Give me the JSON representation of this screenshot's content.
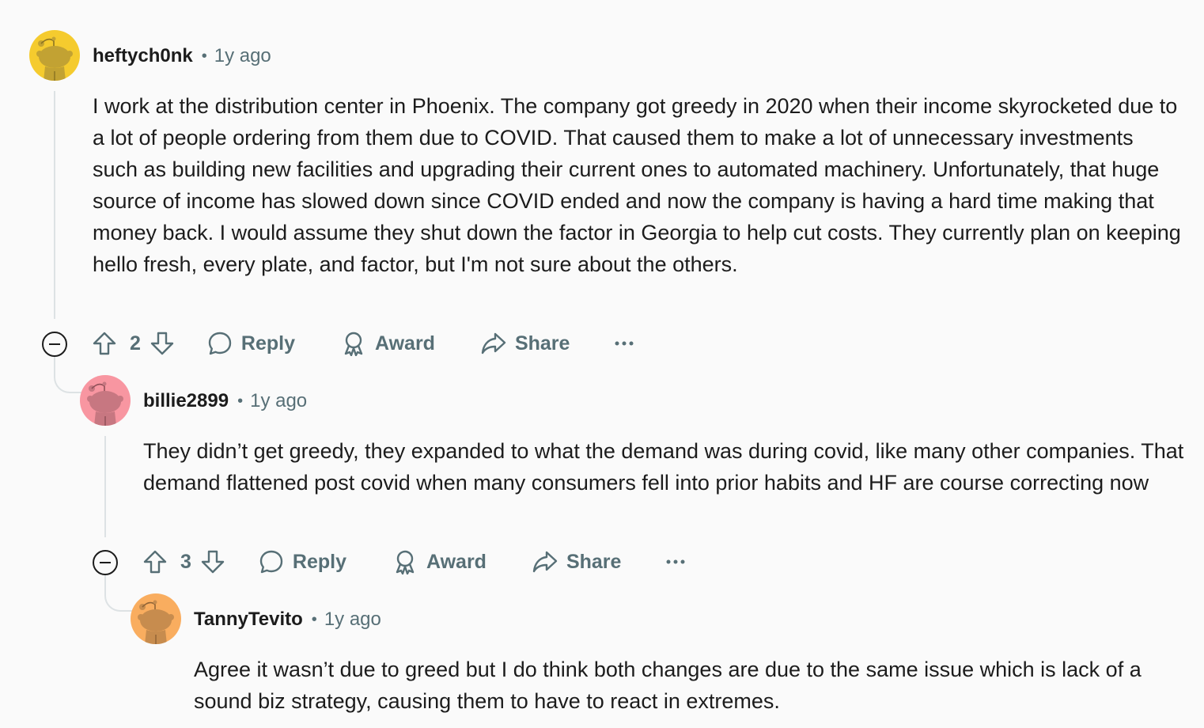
{
  "comments": [
    {
      "username": "heftych0nk",
      "separator": "•",
      "time": "1y ago",
      "body": "I work at the distribution center in Phoenix. The company got greedy in 2020 when their income skyrocketed due to a lot of people ordering from them due to COVID. That caused them to make a lot of unnecessary investments such as building new facilities and upgrading their current ones to automated machinery. Unfortunately, that huge source of income has slowed down since COVID ended and now the company is having a hard time making that money back. I would assume they shut down the factor in Georgia to help cut costs. They currently plan on keeping hello fresh, every plate, and factor, but I'm not sure about the others.",
      "votes": "2",
      "avatar_color": "#f5cb2e",
      "avatar_figure_color": "#c2a233"
    },
    {
      "username": "billie2899",
      "separator": "•",
      "time": "1y ago",
      "body": "They didn’t get greedy, they expanded to what the demand was during covid, like many other companies. That demand flattened post covid when many consumers fell into prior habits and HF are course correcting now",
      "votes": "3",
      "avatar_color": "#f896a1",
      "avatar_figure_color": "#c77781"
    },
    {
      "username": "TannyTevito",
      "separator": "•",
      "time": "1y ago",
      "body": "Agree it wasn’t due to greed but I do think both changes are due to the same issue which is lack of a sound biz strategy, causing them to have to react in extremes.",
      "avatar_color": "#f9ad5f",
      "avatar_figure_color": "#c78c4e"
    }
  ],
  "actions": {
    "reply": "Reply",
    "award": "Award",
    "share": "Share"
  },
  "icons": {
    "upvote": "upvote-icon",
    "downvote": "downvote-icon",
    "reply": "comment-bubble-icon",
    "award": "award-ribbon-icon",
    "share": "share-arrow-icon",
    "more": "more-horizontal-icon",
    "collapse": "collapse-minus-icon"
  },
  "colors": {
    "background": "#fafafa",
    "text": "#1c1c1c",
    "secondary": "#576f76",
    "thread_line": "#dde2e4"
  }
}
